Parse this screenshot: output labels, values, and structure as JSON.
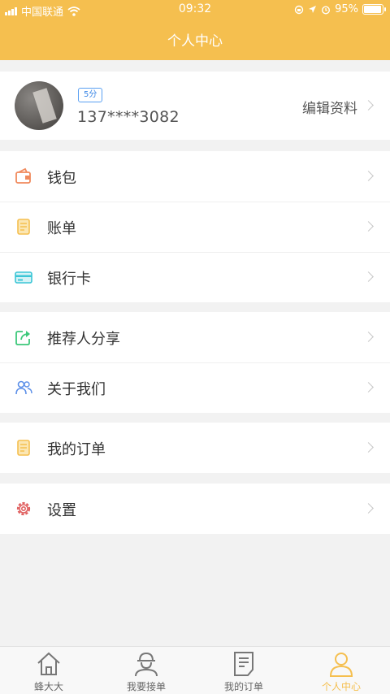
{
  "status_bar": {
    "carrier": "中国联通",
    "time": "09:32",
    "battery": "95%",
    "battery_level": 0.95
  },
  "header": {
    "title": "个人中心"
  },
  "profile": {
    "level_badge": "5分",
    "phone": "137****3082",
    "edit_label": "编辑资料"
  },
  "menu_groups": [
    [
      {
        "label": "钱包",
        "icon": "wallet-icon",
        "color": "#f08a5d"
      },
      {
        "label": "账单",
        "icon": "bill-icon",
        "color": "#f5bf4f"
      },
      {
        "label": "银行卡",
        "icon": "bank-card-icon",
        "color": "#3cc6d6"
      }
    ],
    [
      {
        "label": "推荐人分享",
        "icon": "share-icon",
        "color": "#3cc87a"
      },
      {
        "label": "关于我们",
        "icon": "about-us-icon",
        "color": "#5b8fe8"
      }
    ],
    [
      {
        "label": "我的订单",
        "icon": "order-icon",
        "color": "#f5bf4f"
      }
    ],
    [
      {
        "label": "设置",
        "icon": "settings-icon",
        "color": "#e06060"
      }
    ]
  ],
  "tabs": [
    {
      "label": "蜂大大",
      "icon": "home-icon"
    },
    {
      "label": "我要接单",
      "icon": "worker-icon"
    },
    {
      "label": "我的订单",
      "icon": "order-list-icon"
    },
    {
      "label": "个人中心",
      "icon": "profile-icon",
      "active": true
    }
  ],
  "colors": {
    "accent": "#f5bf4f",
    "background": "#f2f2f2"
  }
}
